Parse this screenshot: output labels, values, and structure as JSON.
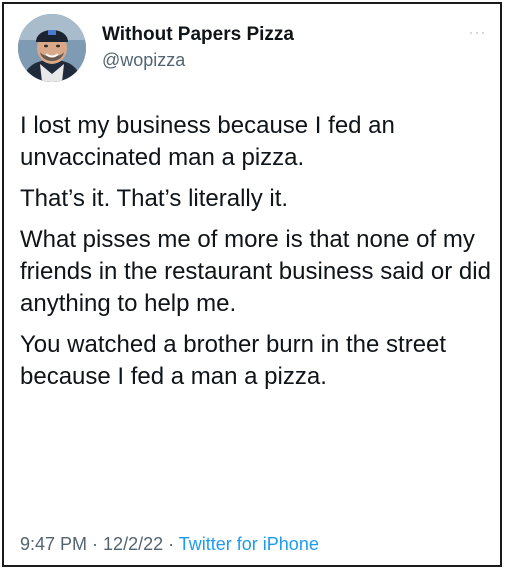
{
  "tweet": {
    "author": {
      "display_name": "Without Papers Pizza",
      "handle": "@wopizza",
      "avatar_icon": "profile-photo"
    },
    "more_icon": "more-dots-icon",
    "paragraphs": [
      "I lost my business because I fed an unvaccinated man a pizza.",
      "That’s it. That’s literally it.",
      "What pisses me of more is that none of my friends in the restaurant business said or did anything to help me.",
      "You watched a brother burn in the street because I fed a man a pizza."
    ],
    "meta": {
      "time": "9:47 PM",
      "separator": " · ",
      "date": "12/2/22",
      "source": "Twitter for iPhone"
    }
  },
  "colors": {
    "text": "#0f1419",
    "secondary": "#536471",
    "link": "#1d9bf0",
    "border": "#1a1a1a"
  }
}
